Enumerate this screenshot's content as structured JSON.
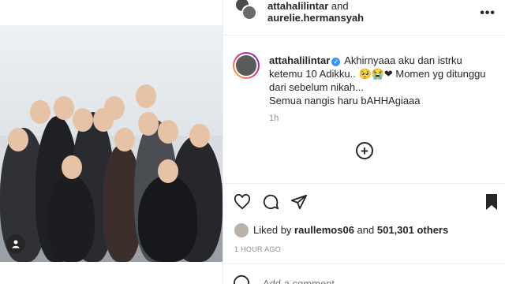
{
  "header": {
    "user1": "attahalilintar",
    "and_text": "and",
    "user2": "aurelie.hermansyah",
    "more_icon": "more-dots-icon"
  },
  "caption": {
    "username": "attahalilintar",
    "line1": "Akhirnyaaa aku dan istrku ketemu 10 Adikku..",
    "emojis": "🥺😭❤",
    "line2": "Momen yg ditunggu dari sebelum nikah...",
    "line3": "Semua nangis haru bAHHAgiaaa",
    "time": "1h"
  },
  "likes": {
    "prefix": "Liked by",
    "user": "raullemos06",
    "middle": "and",
    "count": "501,301 others"
  },
  "post_time": "1 HOUR AGO",
  "comment": {
    "placeholder": "Add a comment..."
  },
  "colors": {
    "text": "#262626",
    "muted": "#8e8e8e",
    "verified": "#3897f0",
    "divider": "#efefef"
  }
}
